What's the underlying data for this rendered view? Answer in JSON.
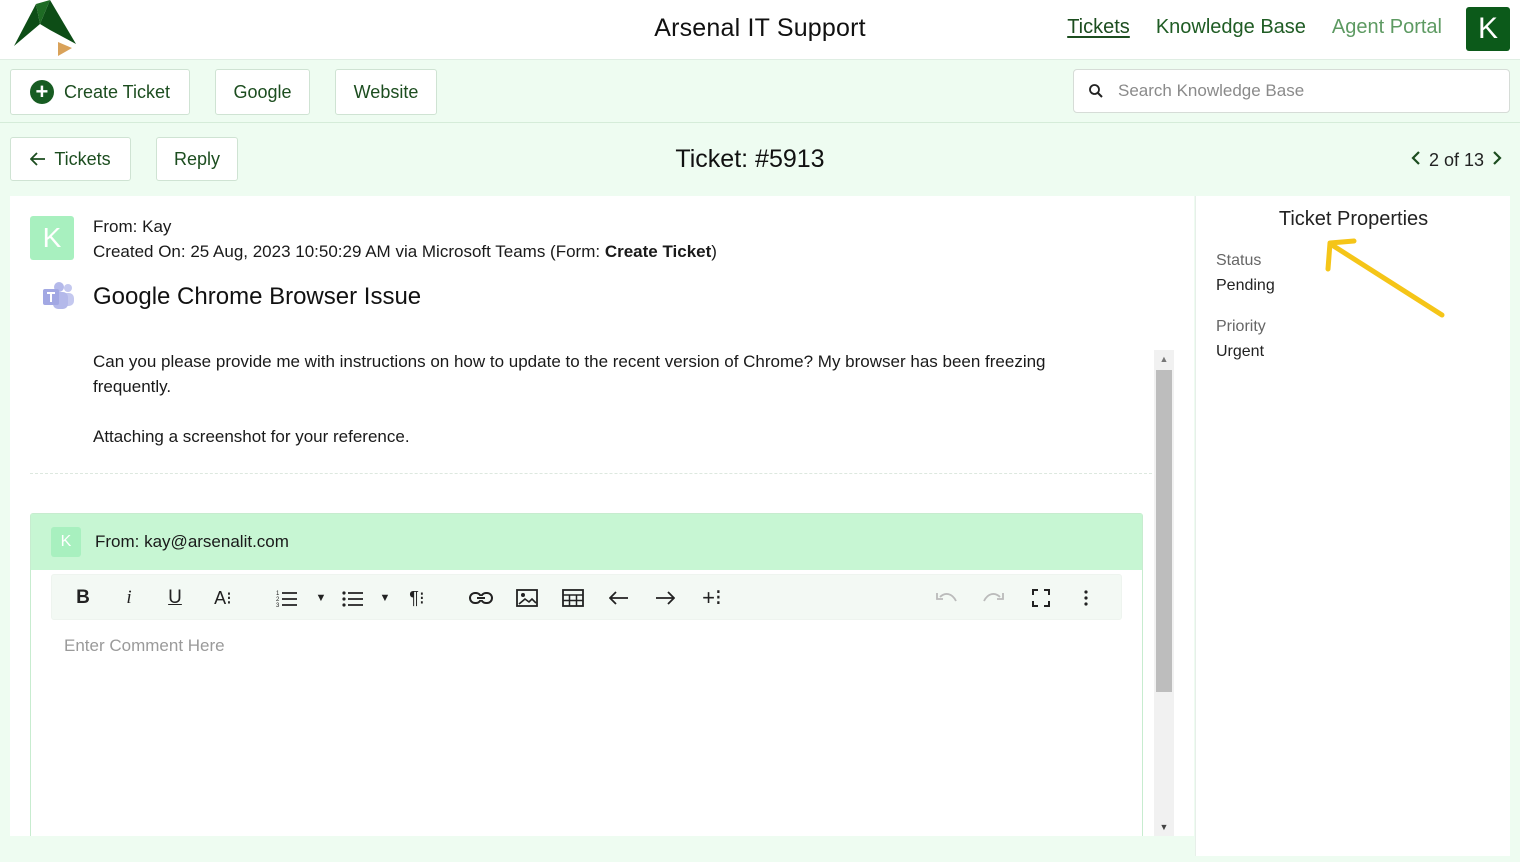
{
  "header": {
    "app_title": "Arsenal IT Support",
    "nav": {
      "tickets": "Tickets",
      "knowledge_base": "Knowledge Base",
      "agent_portal": "Agent Portal"
    },
    "avatar_initial": "K"
  },
  "toolbar": {
    "create_ticket": "Create Ticket",
    "google": "Google",
    "website": "Website",
    "search_placeholder": "Search Knowledge Base"
  },
  "subbar": {
    "back_label": "Tickets",
    "reply_label": "Reply",
    "ticket_title": "Ticket: #5913",
    "pager": "2 of 13"
  },
  "message": {
    "avatar_initial": "K",
    "from": "From: Kay",
    "created_prefix": "Created On: 25 Aug, 2023 10:50:29 AM via Microsoft Teams (Form: ",
    "form_name": "Create Ticket",
    "created_suffix": ")",
    "subject": "Google Chrome Browser Issue",
    "body_1": "Can you please provide me with instructions on how to update to the recent version of Chrome? My browser has been freezing frequently.",
    "body_2": "Attaching a screenshot for your reference."
  },
  "reply": {
    "avatar_initial": "K",
    "from": "From: kay@arsenalit.com",
    "placeholder": "Enter Comment Here"
  },
  "properties": {
    "title": "Ticket Properties",
    "status_label": "Status",
    "status_value": "Pending",
    "priority_label": "Priority",
    "priority_value": "Urgent"
  },
  "colors": {
    "brand_green": "#0c5a1a",
    "page_bg": "#eefcf1",
    "reply_header_bg": "#c7f6d3",
    "annotation_arrow": "#f5c518"
  }
}
